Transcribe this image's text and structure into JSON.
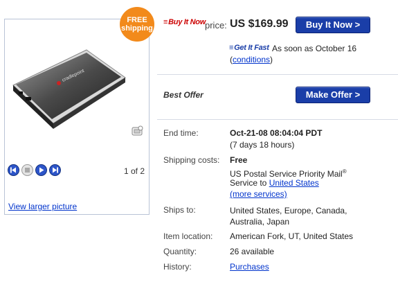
{
  "photo": {
    "badge_line1": "FREE",
    "badge_line2": "shipping",
    "brand_on_device": "cradlepoint",
    "counter": "1 of 2",
    "larger_link": "View larger picture"
  },
  "buy_it_now": {
    "logo": "Buy It Now",
    "price_label": "price:",
    "price": "US $169.99",
    "button": "Buy It Now >"
  },
  "get_it_fast": {
    "logo": "Get It Fast",
    "text": "As soon as October 16",
    "open_paren": "(",
    "link": "conditions",
    "close_paren": ")"
  },
  "best_offer": {
    "label": "Best Offer",
    "button": "Make Offer >"
  },
  "details": {
    "end_time_label": "End time:",
    "end_time": "Oct-21-08 08:04:04 PDT",
    "time_left": "(7 days 18 hours)",
    "shipping_label": "Shipping costs:",
    "shipping_cost": "Free",
    "shipping_service": "US Postal Service Priority Mail",
    "shipping_reg": "®",
    "service_to": "Service to",
    "service_to_link": "United States",
    "more_services": "(more services)",
    "ships_to_label": "Ships to:",
    "ships_to": "United States, Europe, Canada, Australia, Japan",
    "location_label": "Item location:",
    "location": "American Fork, UT, United States",
    "quantity_label": "Quantity:",
    "quantity": "26 available",
    "history_label": "History:",
    "history_link": "Purchases"
  },
  "colors": {
    "button_blue": "#1a3ea8",
    "badge_orange": "#f28a1b",
    "link_blue": "#0033cc",
    "logo_red": "#cc0000"
  }
}
